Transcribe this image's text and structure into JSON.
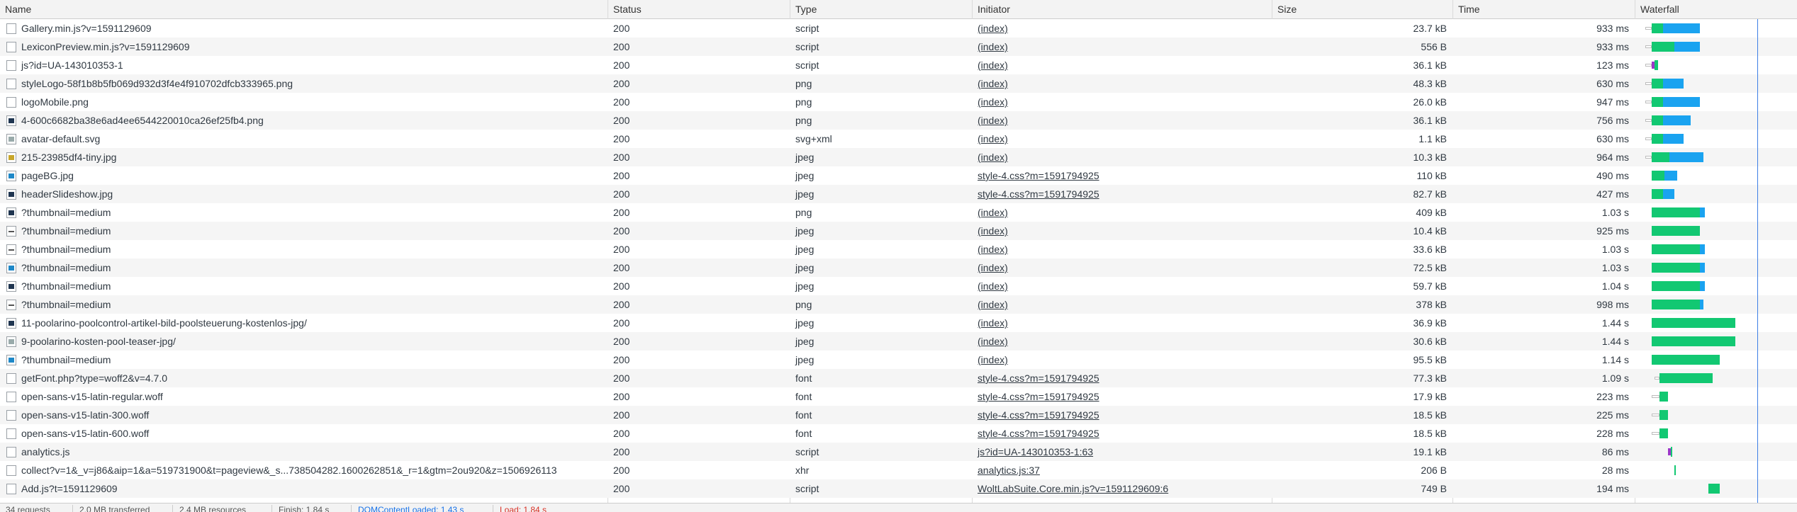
{
  "columns": {
    "name": "Name",
    "status": "Status",
    "type": "Type",
    "initiator": "Initiator",
    "size": "Size",
    "time": "Time",
    "waterfall": "Waterfall"
  },
  "requests": [
    {
      "name": "Gallery.min.js?v=1591129609",
      "status": "200",
      "type": "script",
      "initiator": "(index)",
      "size": "23.7 kB",
      "time": "933 ms",
      "icon": "file-icon",
      "wf": {
        "wait": [
          0.06,
          0.1
        ],
        "green": [
          0.1,
          0.17
        ],
        "blue": [
          0.17,
          0.4
        ]
      }
    },
    {
      "name": "LexiconPreview.min.js?v=1591129609",
      "status": "200",
      "type": "script",
      "initiator": "(index)",
      "size": "556 B",
      "time": "933 ms",
      "icon": "file-icon",
      "wf": {
        "wait": [
          0.06,
          0.1
        ],
        "green": [
          0.1,
          0.24
        ],
        "blue": [
          0.24,
          0.4
        ]
      }
    },
    {
      "name": "js?id=UA-143010353-1",
      "status": "200",
      "type": "script",
      "initiator": "(index)",
      "size": "36.1 kB",
      "time": "123 ms",
      "icon": "file-icon",
      "wf": {
        "wait": [
          0.06,
          0.1
        ],
        "purple": [
          0.1,
          0.12
        ],
        "green": [
          0.12,
          0.14
        ]
      }
    },
    {
      "name": "styleLogo-58f1b8b5fb069d932d3f4e4f910702dfcb333965.png",
      "status": "200",
      "type": "png",
      "initiator": "(index)",
      "size": "48.3 kB",
      "time": "630 ms",
      "icon": "file-icon",
      "wf": {
        "wait": [
          0.06,
          0.1
        ],
        "green": [
          0.1,
          0.17
        ],
        "blue": [
          0.17,
          0.3
        ]
      }
    },
    {
      "name": "logoMobile.png",
      "status": "200",
      "type": "png",
      "initiator": "(index)",
      "size": "26.0 kB",
      "time": "947 ms",
      "icon": "file-icon",
      "wf": {
        "wait": [
          0.06,
          0.1
        ],
        "green": [
          0.1,
          0.17
        ],
        "blue": [
          0.17,
          0.4
        ]
      }
    },
    {
      "name": "4-600c6682ba38e6ad4ee6544220010ca26ef25fb4.png",
      "status": "200",
      "type": "png",
      "initiator": "(index)",
      "size": "36.1 kB",
      "time": "756 ms",
      "icon": "image-dark-icon",
      "wf": {
        "wait": [
          0.06,
          0.1
        ],
        "green": [
          0.1,
          0.17
        ],
        "blue": [
          0.17,
          0.34
        ]
      }
    },
    {
      "name": "avatar-default.svg",
      "status": "200",
      "type": "svg+xml",
      "initiator": "(index)",
      "size": "1.1 kB",
      "time": "630 ms",
      "icon": "image-grey-icon",
      "wf": {
        "wait": [
          0.06,
          0.1
        ],
        "green": [
          0.1,
          0.17
        ],
        "blue": [
          0.17,
          0.3
        ]
      }
    },
    {
      "name": "215-23985df4-tiny.jpg",
      "status": "200",
      "type": "jpeg",
      "initiator": "(index)",
      "size": "10.3 kB",
      "time": "964 ms",
      "icon": "image-yellow-icon",
      "wf": {
        "wait": [
          0.06,
          0.1
        ],
        "green": [
          0.1,
          0.21
        ],
        "blue": [
          0.21,
          0.42
        ]
      }
    },
    {
      "name": "pageBG.jpg",
      "status": "200",
      "type": "jpeg",
      "initiator": "style-4.css?m=1591794925",
      "size": "110 kB",
      "time": "490 ms",
      "icon": "image-blue-icon",
      "wf": {
        "green": [
          0.1,
          0.18
        ],
        "blue": [
          0.18,
          0.26
        ]
      }
    },
    {
      "name": "headerSlideshow.jpg",
      "status": "200",
      "type": "jpeg",
      "initiator": "style-4.css?m=1591794925",
      "size": "82.7 kB",
      "time": "427 ms",
      "icon": "image-dark-icon",
      "wf": {
        "green": [
          0.1,
          0.17
        ],
        "blue": [
          0.17,
          0.24
        ]
      }
    },
    {
      "name": "?thumbnail=medium",
      "status": "200",
      "type": "png",
      "initiator": "(index)",
      "size": "409 kB",
      "time": "1.03 s",
      "icon": "image-dark-icon",
      "wf": {
        "green": [
          0.1,
          0.4
        ],
        "blue": [
          0.4,
          0.43
        ]
      }
    },
    {
      "name": "?thumbnail=medium",
      "status": "200",
      "type": "jpeg",
      "initiator": "(index)",
      "size": "10.4 kB",
      "time": "925 ms",
      "icon": "image-line-icon",
      "wf": {
        "green": [
          0.1,
          0.4
        ]
      }
    },
    {
      "name": "?thumbnail=medium",
      "status": "200",
      "type": "jpeg",
      "initiator": "(index)",
      "size": "33.6 kB",
      "time": "1.03 s",
      "icon": "image-line-icon",
      "wf": {
        "green": [
          0.1,
          0.4
        ],
        "blue": [
          0.4,
          0.43
        ]
      }
    },
    {
      "name": "?thumbnail=medium",
      "status": "200",
      "type": "jpeg",
      "initiator": "(index)",
      "size": "72.5 kB",
      "time": "1.03 s",
      "icon": "image-blue-icon",
      "wf": {
        "green": [
          0.1,
          0.4
        ],
        "blue": [
          0.4,
          0.43
        ]
      }
    },
    {
      "name": "?thumbnail=medium",
      "status": "200",
      "type": "jpeg",
      "initiator": "(index)",
      "size": "59.7 kB",
      "time": "1.04 s",
      "icon": "image-dark-icon",
      "wf": {
        "green": [
          0.1,
          0.4
        ],
        "blue": [
          0.4,
          0.43
        ]
      }
    },
    {
      "name": "?thumbnail=medium",
      "status": "200",
      "type": "png",
      "initiator": "(index)",
      "size": "378 kB",
      "time": "998 ms",
      "icon": "image-line-icon",
      "wf": {
        "green": [
          0.1,
          0.4
        ],
        "blue": [
          0.4,
          0.42
        ]
      }
    },
    {
      "name": "11-poolarino-poolcontrol-artikel-bild-poolsteuerung-kostenlos-jpg/",
      "status": "200",
      "type": "jpeg",
      "initiator": "(index)",
      "size": "36.9 kB",
      "time": "1.44 s",
      "icon": "image-dark-icon",
      "wf": {
        "green": [
          0.1,
          0.62
        ]
      }
    },
    {
      "name": "9-poolarino-kosten-pool-teaser-jpg/",
      "status": "200",
      "type": "jpeg",
      "initiator": "(index)",
      "size": "30.6 kB",
      "time": "1.44 s",
      "icon": "image-grey-icon",
      "wf": {
        "green": [
          0.1,
          0.62
        ]
      }
    },
    {
      "name": "?thumbnail=medium",
      "status": "200",
      "type": "jpeg",
      "initiator": "(index)",
      "size": "95.5 kB",
      "time": "1.14 s",
      "icon": "image-blue-icon",
      "wf": {
        "green": [
          0.1,
          0.52
        ]
      }
    },
    {
      "name": "getFont.php?type=woff2&v=4.7.0",
      "status": "200",
      "type": "font",
      "initiator": "style-4.css?m=1591794925",
      "size": "77.3 kB",
      "time": "1.09 s",
      "icon": "file-icon",
      "wf": {
        "wait": [
          0.12,
          0.15
        ],
        "green": [
          0.15,
          0.48
        ]
      }
    },
    {
      "name": "open-sans-v15-latin-regular.woff",
      "status": "200",
      "type": "font",
      "initiator": "style-4.css?m=1591794925",
      "size": "17.9 kB",
      "time": "223 ms",
      "icon": "file-icon",
      "wf": {
        "wait": [
          0.1,
          0.15
        ],
        "green": [
          0.15,
          0.2
        ]
      }
    },
    {
      "name": "open-sans-v15-latin-300.woff",
      "status": "200",
      "type": "font",
      "initiator": "style-4.css?m=1591794925",
      "size": "18.5 kB",
      "time": "225 ms",
      "icon": "file-icon",
      "wf": {
        "wait": [
          0.1,
          0.15
        ],
        "green": [
          0.15,
          0.2
        ]
      }
    },
    {
      "name": "open-sans-v15-latin-600.woff",
      "status": "200",
      "type": "font",
      "initiator": "style-4.css?m=1591794925",
      "size": "18.5 kB",
      "time": "228 ms",
      "icon": "file-icon",
      "wf": {
        "wait": [
          0.1,
          0.15
        ],
        "green": [
          0.15,
          0.2
        ]
      }
    },
    {
      "name": "analytics.js",
      "status": "200",
      "type": "script",
      "initiator": "js?id=UA-143010353-1:63",
      "size": "19.1 kB",
      "time": "86 ms",
      "icon": "file-icon",
      "wf": {
        "purple": [
          0.2,
          0.22
        ],
        "green": [
          0.22,
          0.23
        ]
      }
    },
    {
      "name": "collect?v=1&_v=j86&aip=1&a=519731900&t=pageview&_s...738504282.1600262851&_r=1&gtm=2ou920&z=1506926113",
      "status": "200",
      "type": "xhr",
      "initiator": "analytics.js:37",
      "size": "206 B",
      "time": "28 ms",
      "icon": "file-icon",
      "wf": {
        "green": [
          0.24,
          0.25
        ]
      }
    },
    {
      "name": "Add.js?t=1591129609",
      "status": "200",
      "type": "script",
      "initiator": "WoltLabSuite.Core.min.js?v=1591129609:6",
      "size": "749 B",
      "time": "194 ms",
      "icon": "file-icon",
      "wf": {
        "green": [
          0.45,
          0.52
        ]
      }
    }
  ],
  "footer": {
    "requests": "34 requests",
    "transferred": "2.0 MB transferred",
    "resources": "2.4 MB resources",
    "finish": "Finish: 1.84 s",
    "domcontentloaded": "DOMContentLoaded: 1.43 s",
    "load": "Load: 1.84 s"
  },
  "colors": {
    "green": "#12c872",
    "blue": "#1aa3f0",
    "purple": "#9b37c8",
    "domline": "#3d7fe6",
    "load": "#d93025"
  }
}
